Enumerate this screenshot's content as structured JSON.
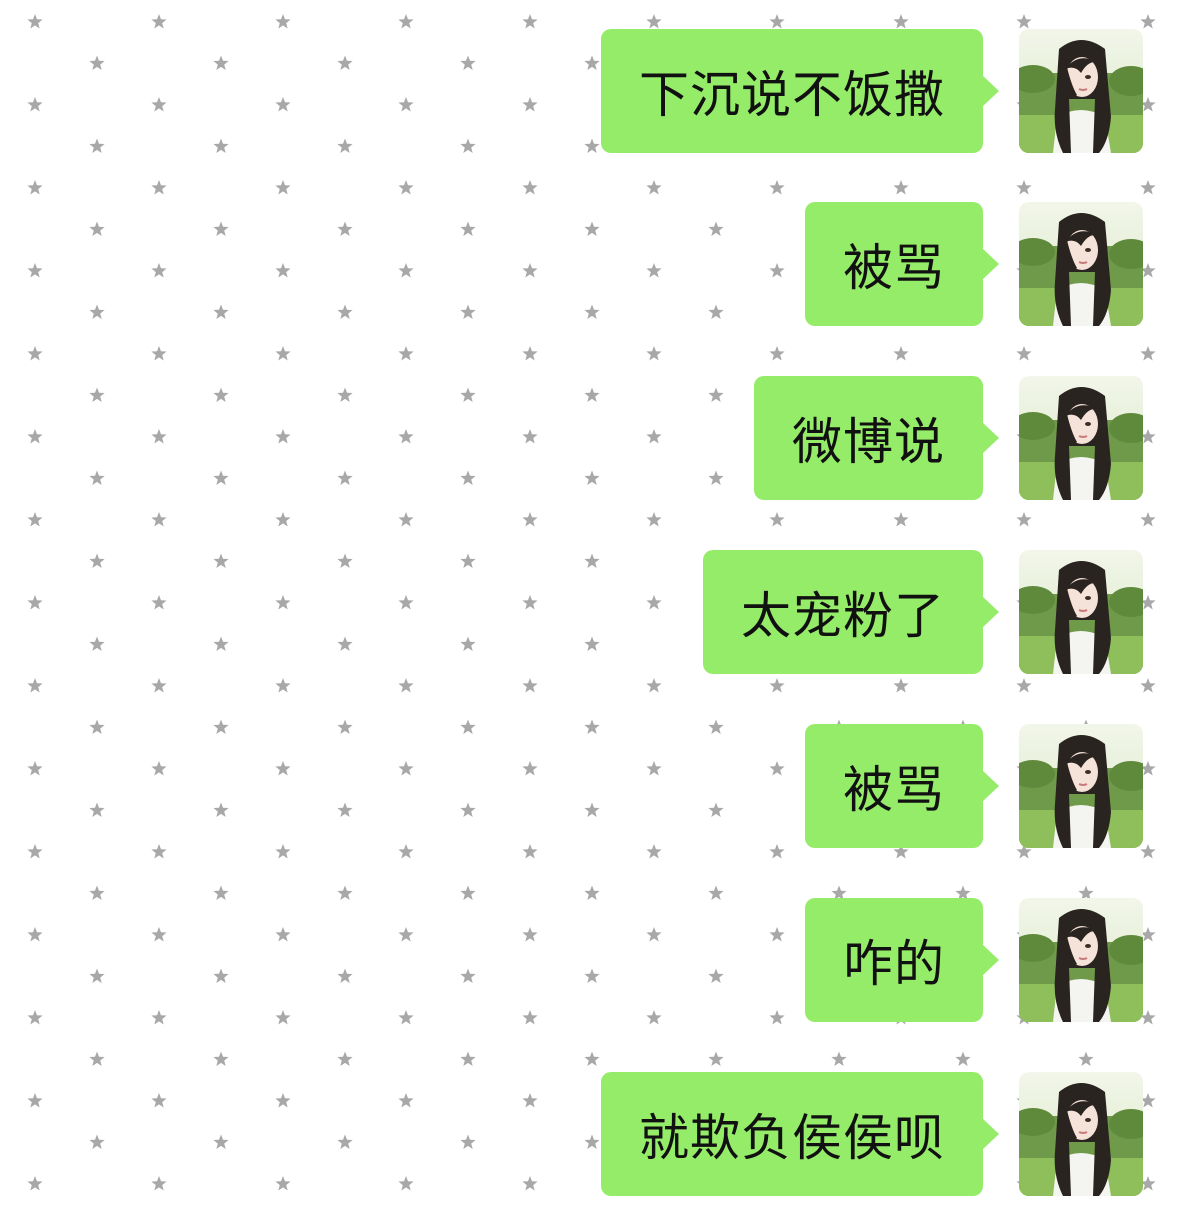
{
  "colors": {
    "bubble": "#95ec69",
    "star": "#a8a8a8",
    "background": "#ffffff",
    "text": "#111111",
    "avatar_background": "#6f9a4a"
  },
  "avatar": {
    "icon": "avatar-photo-icon"
  },
  "messages": [
    {
      "text": "下沉说不饭撒"
    },
    {
      "text": "被骂"
    },
    {
      "text": "微博说"
    },
    {
      "text": "太宠粉了"
    },
    {
      "text": "被骂"
    },
    {
      "text": "咋的"
    },
    {
      "text": "就欺负侯侯呗"
    }
  ]
}
